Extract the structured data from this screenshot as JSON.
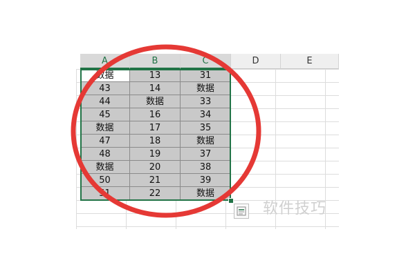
{
  "columns": [
    "A",
    "B",
    "C",
    "D",
    "E"
  ],
  "rows": [
    [
      "数据",
      "13",
      "31"
    ],
    [
      "43",
      "14",
      "数据"
    ],
    [
      "44",
      "数据",
      "33"
    ],
    [
      "45",
      "16",
      "34"
    ],
    [
      "数据",
      "17",
      "35"
    ],
    [
      "47",
      "18",
      "数据"
    ],
    [
      "48",
      "19",
      "37"
    ],
    [
      "数据",
      "20",
      "38"
    ],
    [
      "50",
      "21",
      "39"
    ],
    [
      "51",
      "22",
      "数据"
    ]
  ],
  "watermark": "软件技巧",
  "colors": {
    "accent": "#217346",
    "highlight": "#e53935",
    "selected_fill": "#c9c9c9"
  },
  "icons": {
    "quick_analysis": "quick-analysis-icon"
  }
}
